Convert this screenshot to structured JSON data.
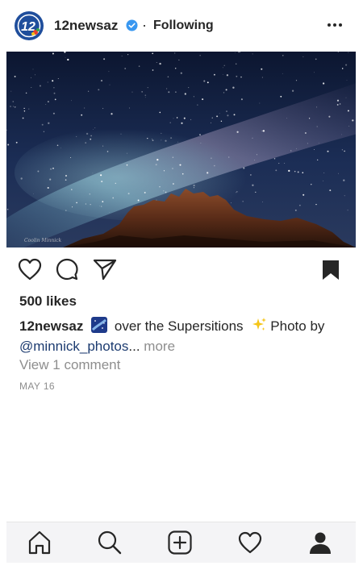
{
  "header": {
    "avatar_text": "12",
    "username": "12newsaz",
    "separator": "·",
    "follow_status": "Following"
  },
  "post": {
    "image_signature": "Coolin Minnick",
    "likes": "500 likes",
    "caption": {
      "username": "12newsaz",
      "text_before_sparkle": "over the Supersitions",
      "text_after_sparkle": "Photo by",
      "mention": "@minnick_photos",
      "ellipsis": "...",
      "more_label": "more"
    },
    "view_comments": "View 1 comment",
    "date": "MAY 16"
  },
  "icons": {
    "more": "more-options-icon",
    "like": "heart-icon",
    "comment": "comment-icon",
    "share": "paper-plane-icon",
    "save": "bookmark-icon",
    "nav": [
      "home-icon",
      "search-icon",
      "add-post-icon",
      "activity-heart-icon",
      "profile-icon"
    ]
  },
  "colors": {
    "brand_blue": "#1f4e9c",
    "verified_blue": "#3897f0",
    "mention": "#1c3b70",
    "muted": "#8e8e8e"
  }
}
